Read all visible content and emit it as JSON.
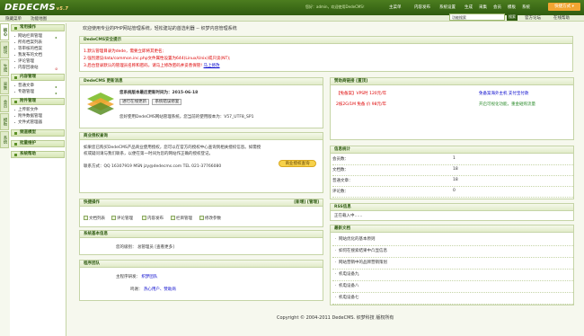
{
  "header": {
    "logo_text": "DEDECMS",
    "logo_version": "v5.7",
    "user_info": "您好：admin，欢迎使用DedeCMS！",
    "nav": [
      "主菜单",
      "内容发布",
      "系统设置",
      "生成",
      "采集",
      "会员",
      "模板",
      "系统"
    ],
    "theme_button": "快捷方式 ▾"
  },
  "subbar": {
    "left_links": [
      "隐藏菜单",
      "功能地图"
    ],
    "search_placeholder": "功能搜索",
    "search_button": "搜索",
    "right_links": [
      "官方论坛",
      "在线帮助"
    ]
  },
  "vtabs": [
    "核心",
    "模块",
    "生成",
    "采集",
    "会员",
    "模板",
    "系统"
  ],
  "left_menu": {
    "groups": [
      {
        "title": "常用操作",
        "items": [
          "网站栏目管理",
          "所有档案列表",
          "等审核的档案",
          "我发布的文档",
          "评论管理",
          "内容回收站"
        ]
      },
      {
        "title": "内容管理",
        "items": [
          "普通文章",
          "专题管理"
        ]
      },
      {
        "title": "附件管理",
        "items": [
          "上传新文件",
          "附件数据管理",
          "文件式管理器"
        ]
      },
      {
        "title": "频道模型",
        "items": []
      },
      {
        "title": "批量维护",
        "items": []
      },
      {
        "title": "系统帮助",
        "items": []
      }
    ]
  },
  "welcome": "欢迎使用专业的PHP网站管理系统，轻松建站的首选利器 -- 织梦内容管理系统",
  "security": {
    "title": "DedeCMS安全提示",
    "lines": [
      "1.默认管理目录为dede，需要立即将其更名;",
      "2.强烈建议data/common.inc.php文件属性设置为644(Linux/Unix)或只读(NT);",
      "3.后台登录默认的管理员名称和密码，请马上修改密码并妥善保管!"
    ],
    "line3_link": "马上修改"
  },
  "update": {
    "title": "DedeCMS 更新消息",
    "headline": "您系统版本最后更新时间为：2015-06-18",
    "buttons": [
      "进行在线更新",
      "系统错误修复"
    ],
    "note": "您好使用DedeCMS网站管理系统，您当前的使用版本为：V57_UTF8_SP1"
  },
  "license": {
    "title": "商业授权查询",
    "text": "如果您已购买DedeCMS产品商业使用授权，您可以在官方的授权中心查询到相关授权信息。如需授权或疑问请与我们联系，以便在第一时间为您的网站作正确的授权登记。",
    "contact": "联系方式：QQ 16307919 MSN jzy@dedecms.com TEL 021-37766080",
    "button": "商业授权查询"
  },
  "quick": {
    "title": "快捷操作",
    "actions": "[新增] [管理]",
    "items": [
      "文档列表",
      "评论管理",
      "内容发布",
      "栏目管理",
      "修改参数"
    ]
  },
  "sysinfo": {
    "title": "系统基本信息",
    "label": "您的级别：",
    "value": "总管理员 [查看更多]"
  },
  "team": {
    "title": "程序团队",
    "rows": [
      {
        "label": "主程序研发：",
        "value": "织梦团队"
      },
      {
        "label": "鸣谢：",
        "value": "热心用户、赞助商"
      }
    ]
  },
  "ads": {
    "title": "赞助商链接 [置顶]",
    "items": [
      {
        "text": "【免备案】VPS时 120元/年",
        "color": "red"
      },
      {
        "text": "免备案海外主机 支付宝付款",
        "color": "blue"
      },
      {
        "text": "2核2G/1M 免备 价 98元/年",
        "color": "red"
      },
      {
        "text": "开启可视化功能，重金砸购流量",
        "color": "green"
      }
    ]
  },
  "stats": {
    "title": "信息统计",
    "rows": [
      {
        "label": "会员数：",
        "value": "1"
      },
      {
        "label": "文档数：",
        "value": "18"
      },
      {
        "label": "普通文章：",
        "value": "18"
      },
      {
        "label": "评论数：",
        "value": "0"
      }
    ]
  },
  "rss": {
    "title": "RSS信息",
    "line": "正在载入中……"
  },
  "news": {
    "title": "最新文档",
    "items": [
      "网站优化的基本原则",
      "如何在搜索结果中凸显信息",
      "网站营销中的品牌营销策划",
      "机电设备九",
      "机电设备八",
      "机电设备七"
    ]
  },
  "footer": "Copyright © 2004-2011 DedeCMS. 织梦科技 版权所有"
}
